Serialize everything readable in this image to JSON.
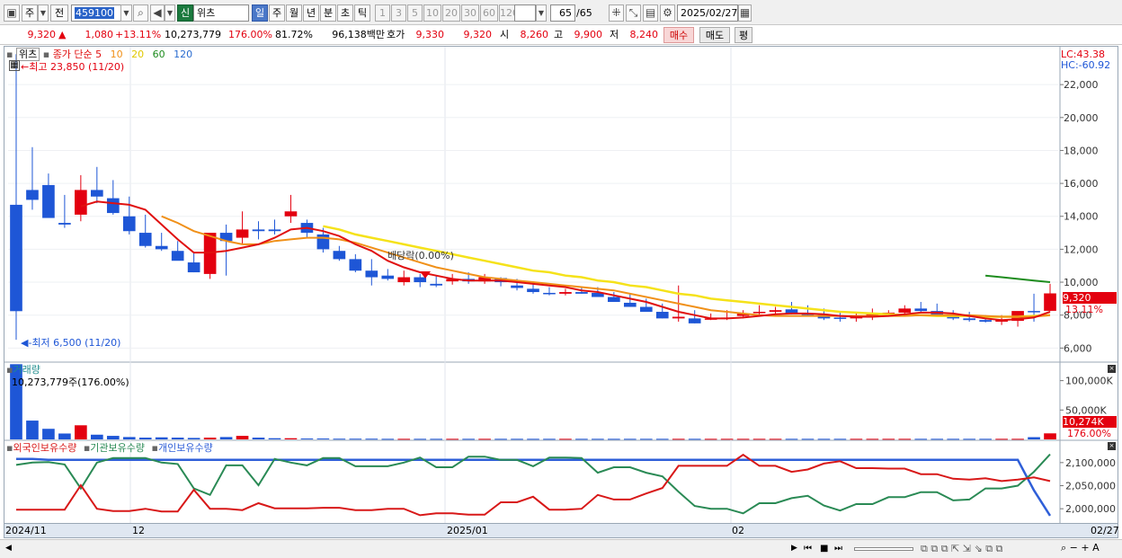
{
  "toolbar": {
    "period_short": "주",
    "prev_label": "전",
    "code": "459100",
    "market_badge": "신",
    "stock_name": "위츠",
    "periods": [
      "일",
      "주",
      "월",
      "년",
      "분",
      "초",
      "틱"
    ],
    "active_period": "일",
    "intervals": [
      "1",
      "3",
      "5",
      "10",
      "20",
      "30",
      "60",
      "120"
    ],
    "count": "65",
    "count_total": "/65",
    "date": "2025/02/27"
  },
  "quote": {
    "price": "9,320",
    "change_arrow": "▲",
    "change": "1,080",
    "change_pct": "+13.11%",
    "volume": "10,273,779",
    "vol_ratio": "176.00%",
    "turnover": "81.72%",
    "amount": "96,138백만",
    "ask_label": "호가",
    "ask1": "9,330",
    "ask2": "9,320",
    "open_label": "시",
    "open": "8,260",
    "high_label": "고",
    "high": "9,900",
    "low_label": "저",
    "low": "8,240",
    "buy_label": "매수",
    "sell_label": "매도",
    "eval_label": "평"
  },
  "price_panel": {
    "name": "위츠",
    "legend_title": "종가 단순",
    "ma_periods": [
      "5",
      "10",
      "20",
      "60",
      "120"
    ],
    "high_note": "최고 23,850 (11/20)",
    "low_note": "최저 6,500 (11/20)",
    "dividend_note": "배당락(0.00%)",
    "lc": "LC:43.38",
    "hc": "HC:-60.92",
    "last_price": "9,320",
    "last_pct": "13.11%",
    "yticks": [
      "22,000",
      "20,000",
      "18,000",
      "16,000",
      "14,000",
      "12,000",
      "10,000",
      "8,000",
      "6,000"
    ]
  },
  "volume_panel": {
    "title": "거래량",
    "value": "10,273,779주(176.00%)",
    "yticks": [
      "100,000K",
      "50,000K"
    ],
    "last_volume": "10,274K",
    "last_ratio": "176.00%"
  },
  "holding_panel": {
    "legend": [
      "외국인보유수량",
      "기관보유수량",
      "개인보유수량"
    ],
    "yticks": [
      "2,100,000",
      "2,050,000",
      "2,000,000"
    ]
  },
  "date_axis": {
    "labels": [
      "2024/11",
      "12",
      "2025/01",
      "02"
    ],
    "right": "02/27"
  },
  "colors": {
    "up": "#e3000f",
    "down": "#1e56d6",
    "ma5": "#e01010",
    "ma10": "#f09018",
    "ma20": "#f5e21a",
    "ma60": "#1e8c1e",
    "ma120": "#2a6cd0",
    "foreign": "#d81818",
    "institution": "#2a8a55",
    "individual": "#2f5fd8"
  },
  "chart_data": {
    "type": "candlestick",
    "dates": [
      "11/20",
      "11/21",
      "11/22",
      "11/25",
      "11/26",
      "11/27",
      "11/28",
      "11/29",
      "12/02",
      "12/03",
      "12/04",
      "12/05",
      "12/06",
      "12/09",
      "12/10",
      "12/11",
      "12/12",
      "12/13",
      "12/16",
      "12/17",
      "12/18",
      "12/19",
      "12/20",
      "12/23",
      "12/24",
      "12/26",
      "12/27",
      "12/30",
      "01/02",
      "01/03",
      "01/06",
      "01/07",
      "01/08",
      "01/09",
      "01/10",
      "01/13",
      "01/14",
      "01/15",
      "01/16",
      "01/17",
      "01/20",
      "01/21",
      "01/22",
      "01/23",
      "01/24",
      "01/31",
      "02/03",
      "02/04",
      "02/05",
      "02/06",
      "02/07",
      "02/10",
      "02/11",
      "02/12",
      "02/13",
      "02/14",
      "02/17",
      "02/18",
      "02/19",
      "02/20",
      "02/21",
      "02/24",
      "02/25",
      "02/26",
      "02/27"
    ],
    "open": [
      14700,
      15600,
      15900,
      13600,
      14100,
      15600,
      15100,
      14000,
      13000,
      12200,
      11900,
      11200,
      10500,
      13000,
      12700,
      13200,
      13200,
      14000,
      13600,
      12900,
      11900,
      11400,
      10700,
      10400,
      10000,
      10300,
      9900,
      10050,
      10200,
      10050,
      10250,
      9800,
      9600,
      9350,
      9300,
      9400,
      9350,
      9100,
      8750,
      8500,
      8200,
      7800,
      7800,
      7800,
      7850,
      7950,
      8150,
      8200,
      8350,
      8100,
      8000,
      7850,
      7800,
      7950,
      8050,
      8150,
      8400,
      8250,
      7950,
      7800,
      7700,
      7600,
      7650,
      8250,
      8260
    ],
    "high": [
      23850,
      18200,
      16600,
      15300,
      16500,
      17000,
      16200,
      15200,
      14100,
      13000,
      12500,
      11800,
      11000,
      13500,
      14300,
      13700,
      13800,
      15300,
      13800,
      13300,
      12200,
      11700,
      11400,
      10800,
      10700,
      10500,
      10400,
      10500,
      10600,
      10500,
      10300,
      10200,
      9900,
      9700,
      9600,
      9700,
      9700,
      9400,
      9300,
      9000,
      8700,
      9800,
      8300,
      8100,
      8300,
      8300,
      8600,
      8500,
      8800,
      8600,
      8400,
      8200,
      8200,
      8400,
      8300,
      8600,
      8800,
      8700,
      8300,
      8200,
      8000,
      8000,
      8200,
      9300,
      9900
    ],
    "low": [
      6500,
      14400,
      14000,
      13300,
      13700,
      14800,
      14100,
      12900,
      12100,
      11900,
      11500,
      10600,
      10200,
      10400,
      12300,
      12600,
      12900,
      13600,
      12700,
      11800,
      11300,
      10600,
      9800,
      10100,
      9800,
      9700,
      9700,
      9850,
      9900,
      9900,
      9750,
      9500,
      9300,
      9200,
      9200,
      9300,
      9150,
      8800,
      8500,
      8300,
      7800,
      7600,
      7500,
      7700,
      7700,
      7800,
      7950,
      8000,
      8050,
      7900,
      7700,
      7600,
      7600,
      7700,
      7900,
      8000,
      8150,
      8000,
      7700,
      7600,
      7550,
      7400,
      7300,
      7600,
      8240
    ],
    "close": [
      8240,
      15000,
      13900,
      13500,
      15600,
      15200,
      14200,
      13100,
      12200,
      12000,
      11300,
      10600,
      13000,
      12500,
      13200,
      13100,
      13100,
      14300,
      13000,
      12000,
      11400,
      10700,
      10300,
      10200,
      10300,
      10000,
      9800,
      10200,
      10050,
      10300,
      10000,
      9650,
      9400,
      9300,
      9400,
      9300,
      9100,
      8800,
      8500,
      8200,
      7800,
      7900,
      7500,
      7800,
      7850,
      8100,
      8200,
      8300,
      8100,
      8000,
      7800,
      7800,
      7950,
      8050,
      8150,
      8400,
      8250,
      7950,
      7800,
      7700,
      7600,
      7700,
      8250,
      8240,
      9320
    ],
    "ma5": [
      null,
      null,
      null,
      null,
      14600,
      14900,
      14800,
      14700,
      14400,
      13500,
      12600,
      11800,
      11800,
      11900,
      12100,
      12300,
      12700,
      13200,
      13300,
      13100,
      12800,
      12300,
      11900,
      11300,
      10900,
      10600,
      10400,
      10200,
      10100,
      10100,
      10100,
      10000,
      9900,
      9800,
      9700,
      9500,
      9400,
      9200,
      9000,
      8800,
      8500,
      8200,
      8000,
      7800,
      7800,
      7850,
      7950,
      8050,
      8100,
      8100,
      8050,
      7950,
      7900,
      7900,
      7950,
      8050,
      8150,
      8150,
      8100,
      7950,
      7800,
      7700,
      7750,
      7850,
      8200
    ],
    "ma10": [
      null,
      null,
      null,
      null,
      null,
      null,
      null,
      null,
      null,
      14000,
      13600,
      13100,
      12800,
      12500,
      12300,
      12300,
      12500,
      12600,
      12700,
      12700,
      12600,
      12400,
      12100,
      11800,
      11500,
      11200,
      10900,
      10700,
      10500,
      10300,
      10200,
      10100,
      10000,
      9900,
      9800,
      9700,
      9600,
      9500,
      9300,
      9100,
      8900,
      8700,
      8500,
      8300,
      8200,
      8100,
      8000,
      7950,
      7950,
      7950,
      7950,
      7950,
      7950,
      7950,
      7950,
      7950,
      8000,
      8000,
      8000,
      8000,
      7950,
      7900,
      7900,
      7900,
      8000
    ],
    "ma20": [
      null,
      null,
      null,
      null,
      null,
      null,
      null,
      null,
      null,
      null,
      null,
      null,
      null,
      null,
      null,
      null,
      null,
      null,
      null,
      13400,
      13200,
      12900,
      12700,
      12500,
      12300,
      12100,
      11900,
      11700,
      11500,
      11300,
      11100,
      10900,
      10700,
      10600,
      10400,
      10300,
      10100,
      10000,
      9800,
      9700,
      9500,
      9300,
      9200,
      9000,
      8900,
      8800,
      8700,
      8600,
      8500,
      8400,
      8300,
      8200,
      8150,
      8100,
      8050,
      8000,
      8000,
      7950,
      7950,
      7950,
      7900,
      7900,
      7900,
      7950,
      8000
    ],
    "ma60": [
      null,
      null,
      null,
      null,
      null,
      null,
      null,
      null,
      null,
      null,
      null,
      null,
      null,
      null,
      null,
      null,
      null,
      null,
      null,
      null,
      null,
      null,
      null,
      null,
      null,
      null,
      null,
      null,
      null,
      null,
      null,
      null,
      null,
      null,
      null,
      null,
      null,
      null,
      null,
      null,
      null,
      null,
      null,
      null,
      null,
      null,
      null,
      null,
      null,
      null,
      null,
      null,
      null,
      null,
      null,
      null,
      null,
      null,
      null,
      null,
      10400,
      10300,
      10200,
      10100,
      10000
    ],
    "volume_k": [
      128000,
      32000,
      18000,
      10000,
      24000,
      8000,
      6000,
      4000,
      3000,
      3500,
      3000,
      2500,
      3000,
      4000,
      6000,
      3000,
      2000,
      2000,
      1500,
      1500,
      1200,
      1200,
      1200,
      1000,
      1000,
      1000,
      1000,
      1000,
      1000,
      1000,
      1000,
      1000,
      1000,
      1000,
      1000,
      1000,
      1000,
      1000,
      1000,
      1000,
      1000,
      1000,
      1000,
      1000,
      1000,
      1000,
      1000,
      1000,
      1000,
      1000,
      1000,
      1000,
      1000,
      1000,
      1000,
      1000,
      1000,
      1000,
      1000,
      1000,
      1000,
      1000,
      1000,
      3800,
      10274
    ],
    "foreign": [
      1998000,
      1998000,
      1998000,
      1998000,
      2051000,
      2000000,
      1995000,
      1995000,
      2000000,
      1994000,
      1994000,
      2041000,
      2000000,
      2000000,
      1997000,
      2012000,
      2001000,
      2001000,
      2001000,
      2002000,
      2002000,
      1997000,
      1997000,
      2000000,
      2000000,
      1986000,
      1990000,
      1990000,
      1987000,
      1987000,
      2014000,
      2014000,
      2026000,
      1998000,
      1998000,
      2000000,
      2030000,
      2020000,
      2020000,
      2033000,
      2045000,
      2093000,
      2093000,
      2093000,
      2093000,
      2117000,
      2093000,
      2093000,
      2080000,
      2085000,
      2098000,
      2103000,
      2088000,
      2088000,
      2087000,
      2087000,
      2075000,
      2075000,
      2065000,
      2063000,
      2066000,
      2060000,
      2063000,
      2068000,
      2060000
    ],
    "institution": [
      2095000,
      2100000,
      2101000,
      2096000,
      2044000,
      2100000,
      2110000,
      2110000,
      2110000,
      2100000,
      2097000,
      2044000,
      2030000,
      2094000,
      2094000,
      2051000,
      2108000,
      2100000,
      2094000,
      2110000,
      2110000,
      2092000,
      2092000,
      2092000,
      2100000,
      2111000,
      2090000,
      2090000,
      2113000,
      2113000,
      2106000,
      2106000,
      2092000,
      2111000,
      2111000,
      2110000,
      2078000,
      2090000,
      2090000,
      2078000,
      2070000,
      2037000,
      2006000,
      2000000,
      2000000,
      1990000,
      2012000,
      2012000,
      2023000,
      2028000,
      2007000,
      1996000,
      2010000,
      2010000,
      2025000,
      2025000,
      2036000,
      2036000,
      2018000,
      2020000,
      2044000,
      2044000,
      2050000,
      2080000,
      2118000
    ],
    "individual": [
      2108000,
      2108000,
      2106000,
      2106000,
      2106000,
      2106000,
      2106000,
      2106000,
      2106000,
      2106000,
      2106000,
      2106000,
      2106000,
      2106000,
      2106000,
      2106000,
      2106000,
      2106000,
      2106000,
      2106000,
      2106000,
      2106000,
      2106000,
      2106000,
      2106000,
      2106000,
      2106000,
      2106000,
      2106000,
      2106000,
      2106000,
      2106000,
      2106000,
      2106000,
      2106000,
      2106000,
      2106000,
      2106000,
      2106000,
      2106000,
      2106000,
      2106000,
      2106000,
      2106000,
      2106000,
      2106000,
      2106000,
      2106000,
      2106000,
      2106000,
      2106000,
      2106000,
      2106000,
      2106000,
      2106000,
      2106000,
      2106000,
      2106000,
      2106000,
      2106000,
      2106000,
      2106000,
      2106000,
      2040000,
      1985000
    ]
  }
}
